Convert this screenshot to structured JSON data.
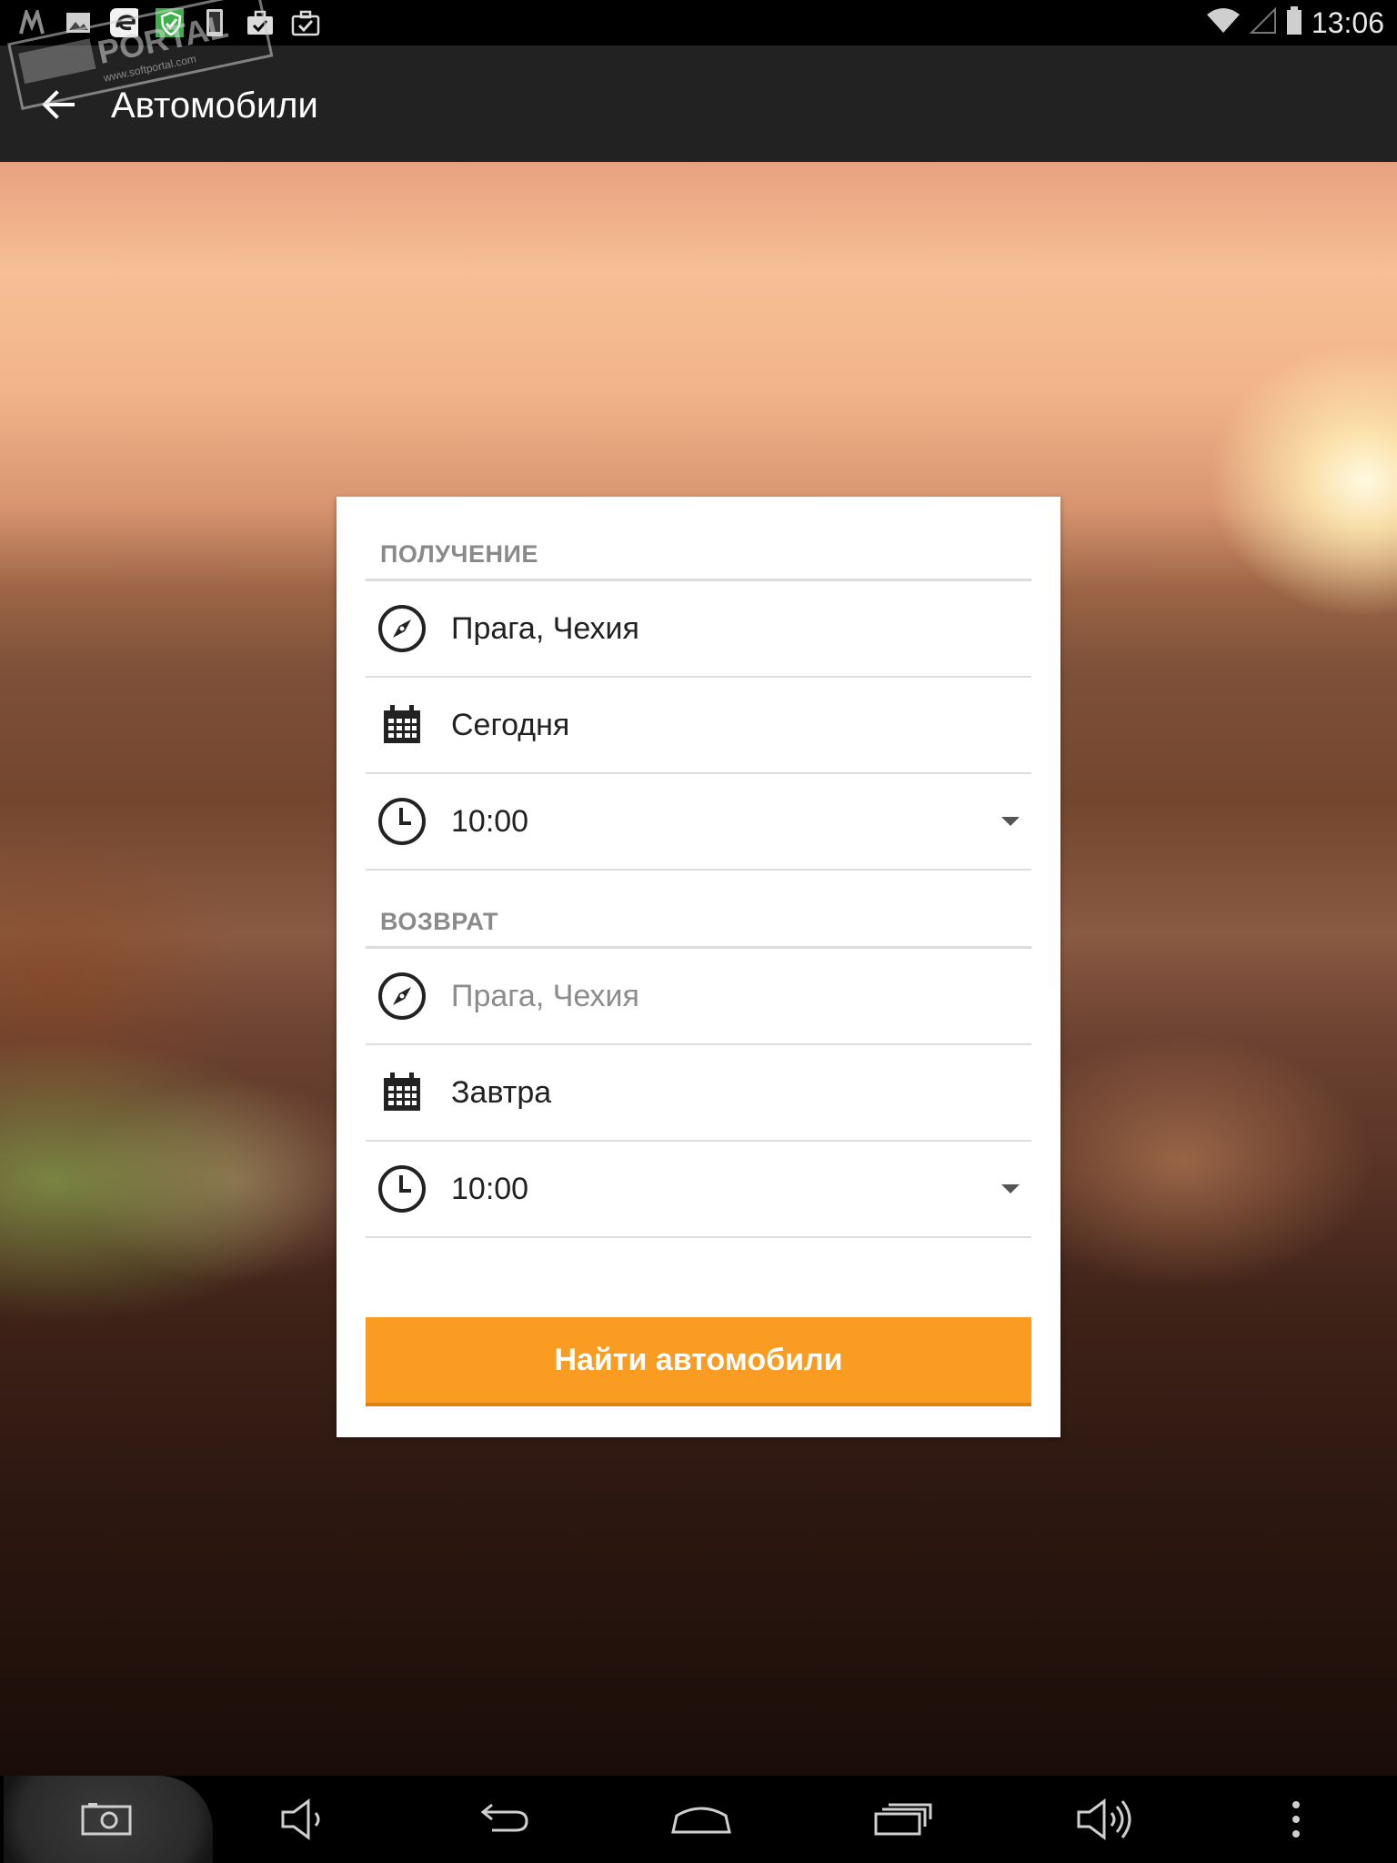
{
  "status_bar": {
    "time": "13:06",
    "notification_icons": [
      "m-icon",
      "image-icon",
      "ereader-icon",
      "shield-icon",
      "phone-icon",
      "briefcase-check-icon",
      "briefcase-check-icon"
    ],
    "wifi": "wifi-icon",
    "signal": "no-signal-icon",
    "battery": "battery-icon"
  },
  "watermark": {
    "text": "SOFTPORTAL",
    "url": "www.softportal.com"
  },
  "action_bar": {
    "back_icon": "arrow-back-icon",
    "title": "Автомобили"
  },
  "pickup": {
    "header": "ПОЛУЧЕНИЕ",
    "location": "Прага, Чехия",
    "date": "Сегодня",
    "time": "10:00"
  },
  "return": {
    "header": "ВОЗВРАТ",
    "location_placeholder": "Прага, Чехия",
    "date": "Завтра",
    "time": "10:00"
  },
  "search_button": "Найти автомобили",
  "colors": {
    "accent": "#fa9b22",
    "action_bar": "#222222",
    "header_text": "#8a8a8a"
  },
  "nav_bar": [
    "screenshot-icon",
    "volume-down-icon",
    "back-icon",
    "home-icon",
    "recents-icon",
    "volume-up-icon",
    "overflow-menu-icon"
  ]
}
